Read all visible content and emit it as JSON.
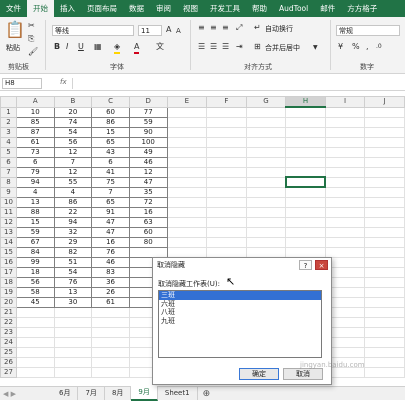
{
  "ribbon_tabs": [
    "文件",
    "开始",
    "插入",
    "页面布局",
    "数据",
    "审阅",
    "视图",
    "开发工具",
    "帮助",
    "AudTool",
    "邮件",
    "方方格子"
  ],
  "active_tab_index": 1,
  "colors": {
    "accent": "#217346",
    "selection_blue": "#3370d3"
  },
  "ribbon": {
    "paste_label": "粘贴",
    "clipboard_group": "剪贴板",
    "font_name": "等线",
    "font_size": "11",
    "font_group": "字体",
    "font_buttons": [
      "B",
      "I",
      "U"
    ],
    "wrap_text": "自动换行",
    "merge_center": "合并后居中",
    "alignment_group": "对齐方式",
    "number_format": "常规",
    "number_group": "数字",
    "icons": [
      "paste-icon",
      "cut-icon",
      "copy-icon",
      "format-painter-icon",
      "bold-icon",
      "italic-icon",
      "underline-icon",
      "wrap-text-icon",
      "merge-center-icon"
    ]
  },
  "formula_bar": {
    "cell_ref": "H8",
    "fx": "fx",
    "formula": ""
  },
  "sheet": {
    "column_headers": [
      "A",
      "B",
      "C",
      "D",
      "E",
      "F",
      "G",
      "H",
      "I",
      "J"
    ],
    "selected_column": "H",
    "selected_cell": "H8",
    "row_count": 27,
    "data": [
      [
        "10",
        "20",
        "60",
        "77"
      ],
      [
        "85",
        "74",
        "86",
        "59"
      ],
      [
        "87",
        "54",
        "15",
        "90"
      ],
      [
        "61",
        "56",
        "65",
        "100"
      ],
      [
        "73",
        "12",
        "43",
        "49"
      ],
      [
        "6",
        "7",
        "6",
        "46"
      ],
      [
        "79",
        "12",
        "41",
        "12"
      ],
      [
        "94",
        "55",
        "75",
        "47"
      ],
      [
        "4",
        "4",
        "7",
        "35"
      ],
      [
        "13",
        "86",
        "65",
        "72"
      ],
      [
        "88",
        "22",
        "91",
        "16"
      ],
      [
        "15",
        "94",
        "47",
        "63"
      ],
      [
        "59",
        "32",
        "47",
        "60"
      ],
      [
        "67",
        "29",
        "16",
        "80"
      ],
      [
        "84",
        "82",
        "76",
        ""
      ],
      [
        "99",
        "51",
        "46",
        ""
      ],
      [
        "18",
        "54",
        "83",
        ""
      ],
      [
        "56",
        "76",
        "36",
        ""
      ],
      [
        "58",
        "13",
        "26",
        ""
      ],
      [
        "45",
        "30",
        "61",
        ""
      ]
    ]
  },
  "sheet_tabs": [
    "6月",
    "7月",
    "8月",
    "9月",
    "Sheet1"
  ],
  "active_sheet_index": 3,
  "dialog": {
    "title": "取消隐藏",
    "help_button": "?",
    "close_button": "×",
    "list_label": "取消隐藏工作表(U):",
    "items": [
      "三班",
      "六班",
      "八班",
      "九班"
    ],
    "selected_index": 0,
    "ok_label": "确定",
    "cancel_label": "取消"
  },
  "watermark": "jingyan.baidu.com"
}
